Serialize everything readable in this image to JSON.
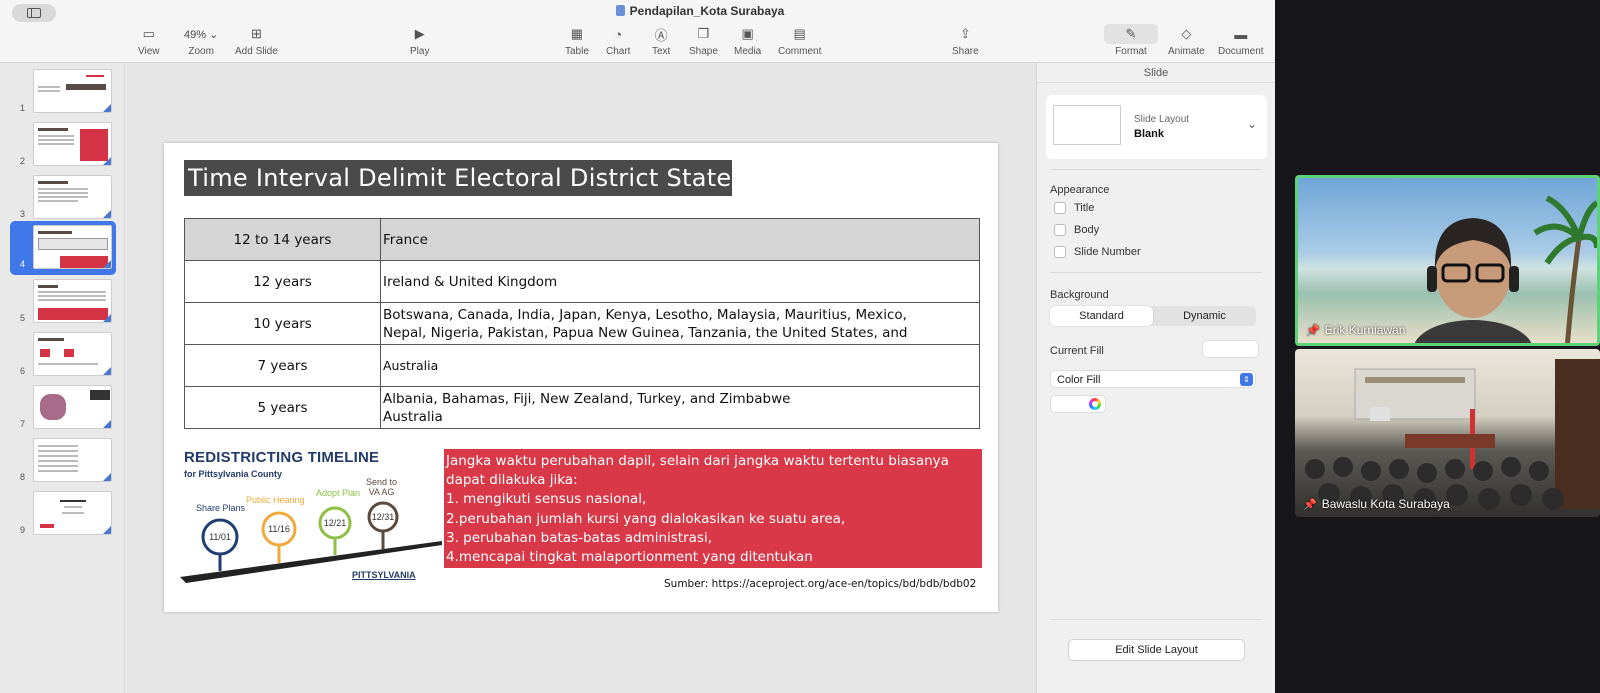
{
  "window": {
    "title": "Pendapilan_Kota Surabaya"
  },
  "toolbar": {
    "view": "View",
    "zoom_value": "49%",
    "zoom": "Zoom",
    "add_slide": "Add Slide",
    "play": "Play",
    "table": "Table",
    "chart": "Chart",
    "text": "Text",
    "shape": "Shape",
    "media": "Media",
    "comment": "Comment",
    "share": "Share",
    "format": "Format",
    "animate": "Animate",
    "document": "Document"
  },
  "navigator": {
    "slides": [
      "1",
      "2",
      "3",
      "4",
      "5",
      "6",
      "7",
      "8",
      "9"
    ],
    "selected": "4"
  },
  "slide": {
    "title": "Time Interval Delimit Electoral District State",
    "table": [
      {
        "years": "12 to 14 years",
        "countries": "France"
      },
      {
        "years": "12 years",
        "countries": "Ireland & United Kingdom"
      },
      {
        "years": "10 years",
        "countries_line1": "Botswana, Canada, India, Japan, Kenya, Lesotho, Malaysia, Mauritius, Mexico,",
        "countries_line2": "Nepal, Nigeria, Pakistan, Papua New Guinea, Tanzania, the United States, and"
      },
      {
        "years": "7 years",
        "countries": "Australia"
      },
      {
        "years": "5 years",
        "countries_line1": "Albania, Bahamas, Fiji, New Zealand, Turkey, and Zimbabwe",
        "countries_line2": "Australia"
      }
    ],
    "timeline": {
      "title": "REDISTRICTING TIMELINE",
      "subtitle": "for Pittsylvania County",
      "steps": [
        {
          "caption": "Share Plans",
          "date": "11/01",
          "color": "#1f3d6e"
        },
        {
          "caption": "Public Hearing",
          "date": "11/16",
          "color": "#f2a93b"
        },
        {
          "caption": "Adopt Plan",
          "date": "12/21",
          "color": "#8fbf45"
        },
        {
          "caption_line1": "Send to",
          "caption_line2": "VA AG",
          "date": "12/31",
          "color": "#5b4a3f"
        }
      ],
      "brand": "PITTSYLVANIA"
    },
    "note_lines": [
      "Jangka waktu perubahan dapil, selain dari jangka waktu tertentu biasanya",
      "dapat dilakuka jika:",
      "1. mengikuti sensus nasional,",
      "2.perubahan jumlah kursi yang dialokasikan ke suatu area,",
      "3. perubahan batas-batas administrasi,",
      "4.mencapai tingkat malaportionment yang ditentukan"
    ],
    "source": "Sumber: https://aceproject.org/ace-en/topics/bd/bdb/bdb02"
  },
  "inspector": {
    "header": "Slide",
    "layout_label": "Slide Layout",
    "layout_value": "Blank",
    "appearance": "Appearance",
    "title_cb": "Title",
    "body_cb": "Body",
    "slide_number_cb": "Slide Number",
    "background": "Background",
    "standard": "Standard",
    "dynamic": "Dynamic",
    "current_fill": "Current Fill",
    "color_fill": "Color Fill",
    "edit_layout": "Edit Slide Layout"
  },
  "participants": [
    {
      "name": "Erik Kurniawan"
    },
    {
      "name": "Bawaslu Kota Surabaya"
    }
  ],
  "colors": {
    "accent": "#3f76e8",
    "slide_title_bg": "#4a4a4a",
    "note_bg": "#d83848",
    "active_speaker": "#5ed27a"
  }
}
